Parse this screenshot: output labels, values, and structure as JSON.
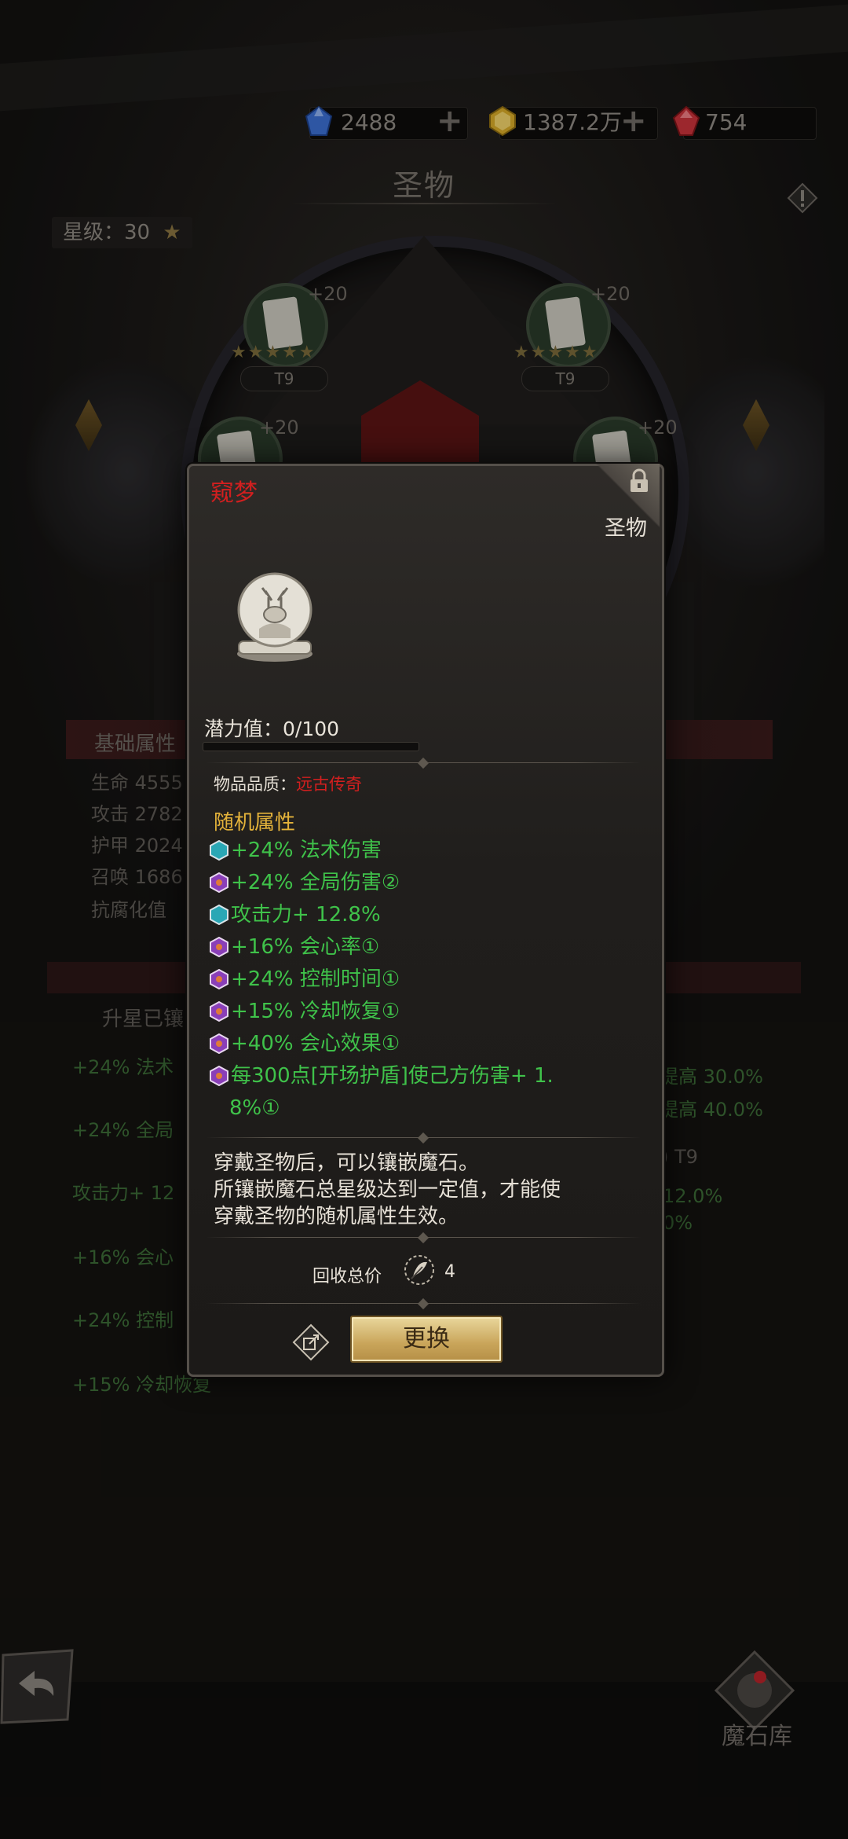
{
  "resources": [
    {
      "icon": "blue-gem-icon",
      "value": "2488",
      "color": "#3b6fd1"
    },
    {
      "icon": "gold-gem-icon",
      "value": "1387.2万",
      "color": "#d6a928"
    },
    {
      "icon": "red-gem-icon",
      "value": "754",
      "color": "#c8333a"
    }
  ],
  "page_title": "圣物",
  "star_level": {
    "label": "星级：30",
    "icon": "star-icon"
  },
  "slots": {
    "bonus": "+20",
    "tier": "T9",
    "stars": "★★★★★"
  },
  "background_stats": {
    "header": "基础属性",
    "rows": [
      {
        "label": "生命",
        "value": "4555"
      },
      {
        "label": "攻击",
        "value": "2782"
      },
      {
        "label": "护甲",
        "value": "2024"
      },
      {
        "label": "召唤",
        "value": "1686"
      },
      {
        "label": "抗腐化值",
        "value": ""
      }
    ],
    "upgrade_label": "升星已镶",
    "green_left": [
      "+24% 法术",
      "+24% 全局",
      "攻击力+ 12",
      "+16% 会心",
      "+24% 控制",
      "+15% 冷却恢复"
    ],
    "right_fragments": [
      "提高 30.0%",
      "提高 40.0%",
      ") T9",
      "12.0%",
      "0%"
    ]
  },
  "bottom": {
    "back_icon": "back-arrow-icon",
    "vault_label": "魔石库",
    "vault_icon": "magic-stone-vault-icon"
  },
  "popup": {
    "name": "窥梦",
    "type": "圣物",
    "item_icon": "snow-globe-icon",
    "potential_label": "潜力值：0/100",
    "potential_fraction": 0,
    "quality_label": "物品品质：",
    "quality_value": "远古传奇",
    "random_title": "随机属性",
    "affixes": [
      {
        "icon": "teal-gem-icon",
        "text": "+24% 法术伤害",
        "color": "teal"
      },
      {
        "icon": "purple-gem-icon",
        "text": "+24% 全局伤害②",
        "color": "purple"
      },
      {
        "icon": "teal-gem-icon",
        "text": "攻击力+ 12.8%",
        "color": "teal"
      },
      {
        "icon": "purple-gem-icon",
        "text": "+16% 会心率①",
        "color": "purple"
      },
      {
        "icon": "purple-gem-icon",
        "text": "+24% 控制时间①",
        "color": "purple"
      },
      {
        "icon": "purple-gem-icon",
        "text": "+15% 冷却恢复①",
        "color": "purple"
      },
      {
        "icon": "purple-gem-icon",
        "text": "+40% 会心效果①",
        "color": "purple"
      },
      {
        "icon": "purple-gem-icon",
        "text": "每300点[开场护盾]使己方伤害+ 1.",
        "color": "purple"
      }
    ],
    "affix_continuation": "8%①",
    "description": [
      "穿戴圣物后，可以镶嵌魔石。",
      "所镶嵌魔石总星级达到一定值，才能使",
      "穿戴圣物的随机属性生效。"
    ],
    "recycle_label": "回收总价",
    "recycle_icon": "feather-coin-icon",
    "recycle_value": "4",
    "share_icon": "share-icon",
    "replace_label": "更换"
  }
}
